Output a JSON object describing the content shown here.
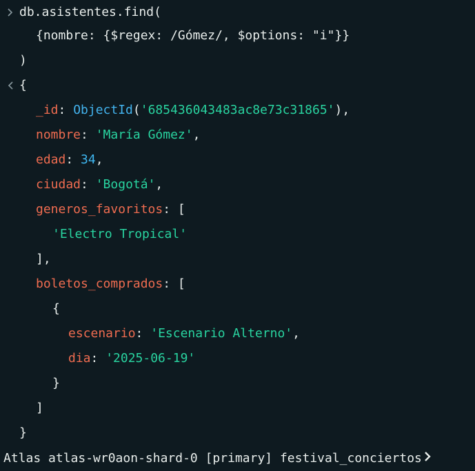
{
  "command": {
    "line1": "db.asistentes.find(",
    "line2": "{nombre: {$regex: /Gómez/, $options: \"i\"}}",
    "line3": ")"
  },
  "result": {
    "open_brace": "{",
    "id_key": "_id",
    "id_fn": "ObjectId",
    "id_value": "'685436043483ac8e73c31865'",
    "nombre_key": "nombre",
    "nombre_value": "'María Gómez'",
    "edad_key": "edad",
    "edad_value": "34",
    "ciudad_key": "ciudad",
    "ciudad_value": "'Bogotá'",
    "generos_key": "generos_favoritos",
    "generos_item": "'Electro Tropical'",
    "boletos_key": "boletos_comprados",
    "escenario_key": "escenario",
    "escenario_value": "'Escenario Alterno'",
    "dia_key": "dia",
    "dia_value": "'2025-06-19'",
    "close_brace": "}"
  },
  "status_bar": {
    "text": "Atlas atlas-wr0aon-shard-0 [primary] festival_conciertos"
  },
  "icons": {
    "input_prompt": "chevron-right-icon",
    "output_marker": "chevron-left-icon",
    "shell_prompt": "chevron-right-icon"
  },
  "colors": {
    "background": "#0e1a20",
    "key": "#ef6c50",
    "string": "#29d4a0",
    "number": "#3fb8f2",
    "function": "#43b3ee",
    "text": "#e8edeb"
  }
}
